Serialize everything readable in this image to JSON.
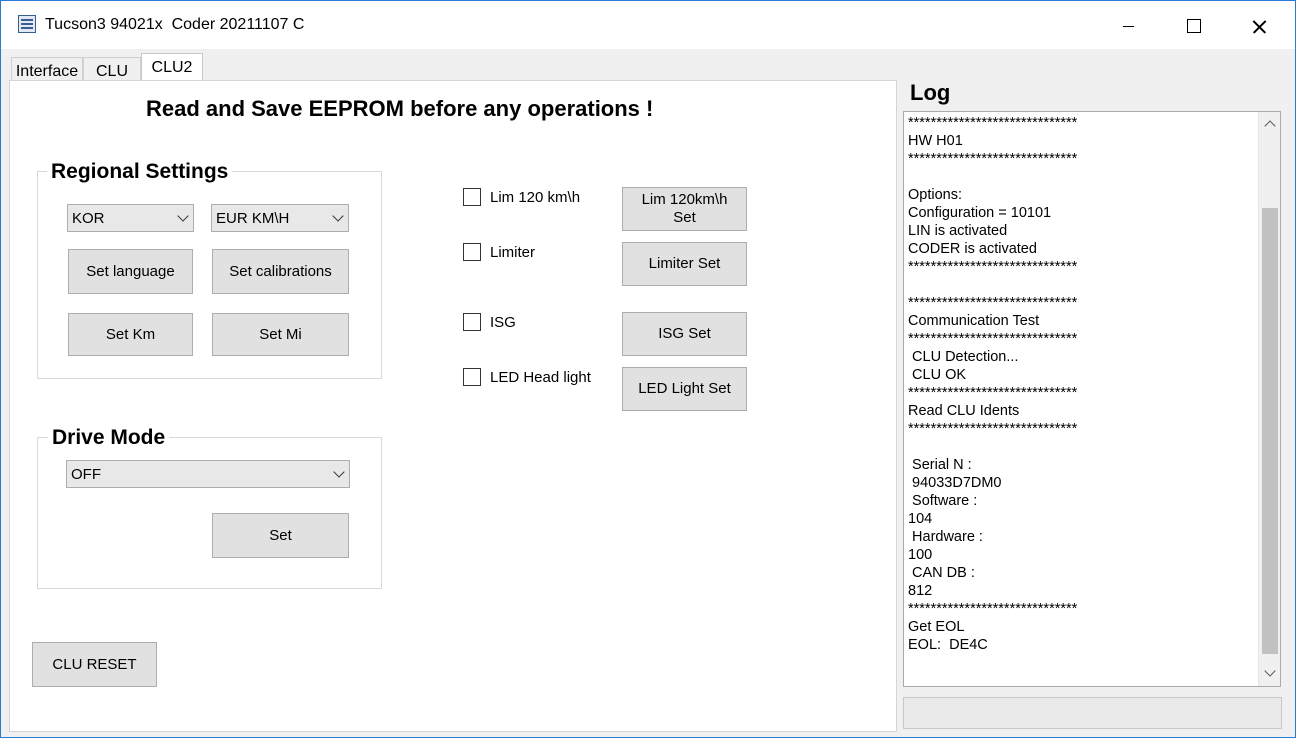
{
  "window": {
    "title": "Tucson3 94021x  Coder 20211107 C"
  },
  "tabs": [
    {
      "label": "Interface"
    },
    {
      "label": "CLU"
    },
    {
      "label": "CLU2"
    }
  ],
  "main": {
    "warning": "Read and Save EEPROM before any operations !",
    "regional": {
      "title": "Regional Settings",
      "language_select": "KOR",
      "calibration_select": "EUR KM\\H",
      "set_language": "Set language",
      "set_calibrations": "Set calibrations",
      "set_km": "Set Km",
      "set_mi": "Set Mi"
    },
    "drive_mode": {
      "title": "Drive Mode",
      "select": "OFF",
      "set": "Set"
    },
    "options": {
      "lim120_label": "Lim 120 km\\h",
      "lim120_set": "Lim 120km\\h\nSet",
      "limiter_label": "Limiter",
      "limiter_set": "Limiter Set",
      "isg_label": "ISG",
      "isg_set": "ISG Set",
      "led_label": "LED Head light",
      "led_set": "LED Light Set"
    },
    "clu_reset": "CLU RESET"
  },
  "log": {
    "title": "Log",
    "text": "******************************\nHW H01\n******************************\n\nOptions:\nConfiguration = 10101\nLIN is activated\nCODER is activated\n******************************\n\n******************************\nCommunication Test\n******************************\n CLU Detection...\n CLU OK\n******************************\nRead CLU Idents\n******************************\n\n Serial N :\n 94033D7DM0\n Software :\n104\n Hardware :\n100\n CAN DB :\n812\n******************************\nGet EOL\nEOL:  DE4C\n\n\n******************************"
  },
  "colors": {
    "window_border": "#2b79d6",
    "button_bg": "#e1e1e1",
    "scroll_thumb": "#c1c1c1"
  }
}
